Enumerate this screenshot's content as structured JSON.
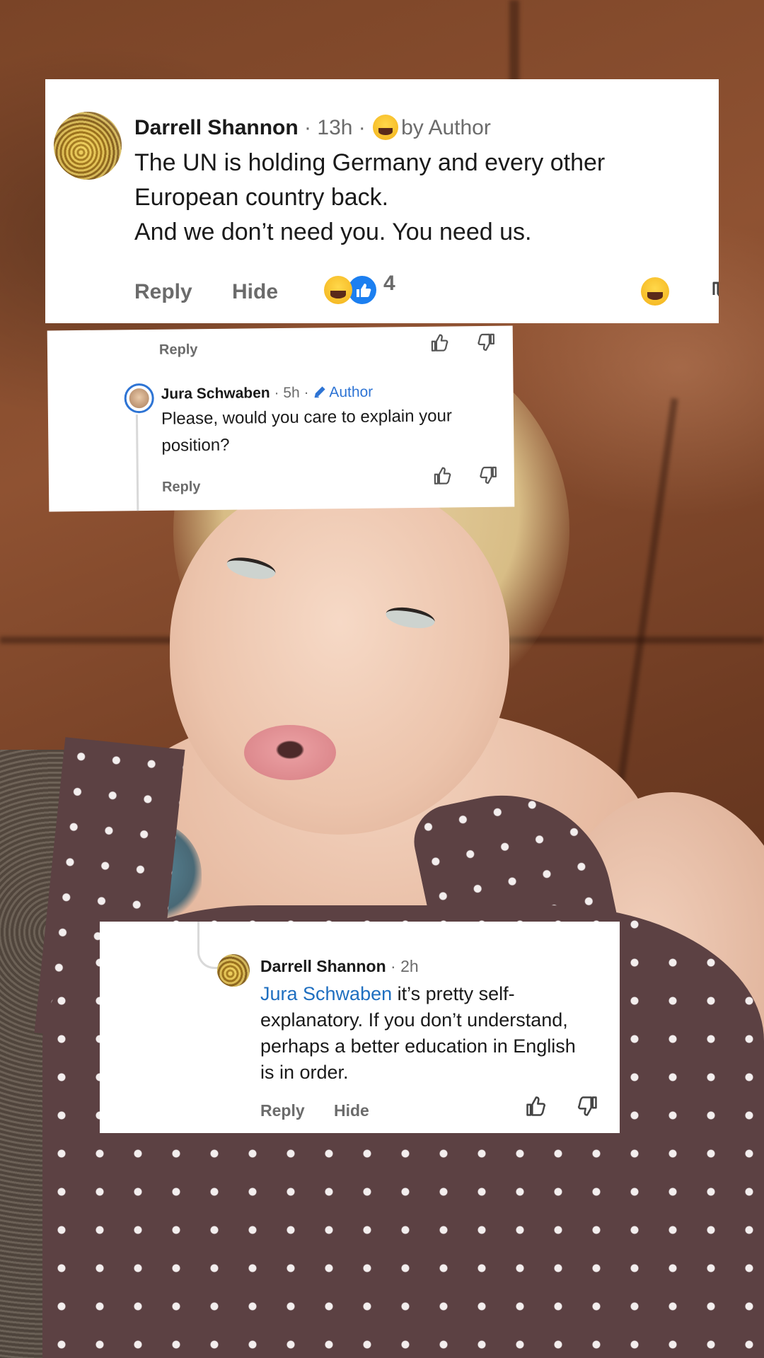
{
  "comments": [
    {
      "author": "Darrell Shannon",
      "meta": " · 13h · ",
      "badge": "by Author",
      "lines": [
        "The UN is holding Germany and every other",
        "European country back.",
        "And we don’t need you. You need us."
      ],
      "reply_label": "Reply",
      "hide_label": "Hide",
      "reaction_count": "4"
    },
    {
      "partial_reply_label": "Reply",
      "author": "Jura Schwaben",
      "meta": " · 5h · ",
      "badge": "Author",
      "lines": [
        "Please, would you care to explain your",
        "position?"
      ],
      "reply_label": "Reply"
    },
    {
      "author": "Darrell Shannon",
      "meta": " · 2h",
      "mention": "Jura Schwaben",
      "lines": [
        " it’s pretty self-",
        "explanatory. If you don’t understand,",
        "perhaps a better education in English",
        "is in order."
      ],
      "reply_label": "Reply",
      "hide_label": "Hide"
    }
  ],
  "colors": {
    "link": "#1f6fc0",
    "author_badge": "#2e74d4",
    "like_badge": "#1c7ff0"
  },
  "icons": [
    "laughing-emoji-icon",
    "thumbs-up-icon",
    "thumbs-down-icon",
    "pencil-icon"
  ]
}
